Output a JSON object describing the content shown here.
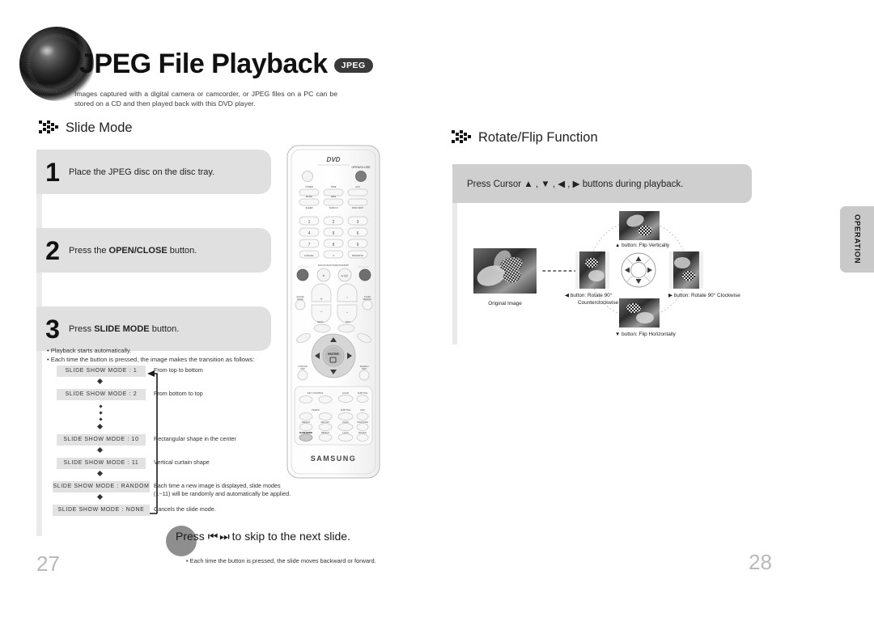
{
  "header": {
    "title": "JPEG File Playback",
    "badge": "JPEG",
    "intro": "Images captured with a digital camera or camcorder, or JPEG files on a PC can be stored on a CD and then played back with this DVD player."
  },
  "left": {
    "section_title": "Slide Mode",
    "steps": [
      {
        "num": "1",
        "text_before": "Place the JPEG disc on the disc tray.",
        "bold": "",
        "text_after": ""
      },
      {
        "num": "2",
        "text_before": "Press the ",
        "bold": "OPEN/CLOSE",
        "text_after": " button."
      },
      {
        "num": "3",
        "text_before": "Press ",
        "bold": "SLIDE MODE",
        "text_after": " button."
      }
    ],
    "notes": [
      "• Playback starts automatically.",
      "• Each time the button is pressed, the image makes the transition as follows:"
    ],
    "flow": [
      {
        "label": "SLIDE SHOW MODE : 1",
        "desc": "From top to bottom"
      },
      {
        "label": "SLIDE SHOW MODE : 2",
        "desc": "From bottom to top"
      },
      {
        "label": "SLIDE SHOW MODE : 10",
        "desc": "Rectangular shape in the center"
      },
      {
        "label": "SLIDE SHOW MODE : 11",
        "desc": "Vertical curtain shape"
      },
      {
        "label": "SLIDE SHOW MODE : RANDOM",
        "desc": "Each time a new image is displayed, slide modes\n(1~11) will be randomly and automatically be applied."
      },
      {
        "label": "SLIDE SHOW MODE : NONE",
        "desc": "Cancels the slide mode."
      }
    ],
    "press": {
      "prefix": "Press",
      "icons": "⏮ ⏭",
      "suffix": "to skip to the next slide.",
      "note": "• Each time the button is pressed, the slide moves backward or forward."
    },
    "page_number": "27"
  },
  "right": {
    "section_title": "Rotate/Flip Function",
    "cursor_instruction": "Press Cursor ▲ , ▼ , ◀ , ▶ buttons during playback.",
    "diagram": {
      "original_caption": "Original Image",
      "up_label": "▲ button: Flip Vertically",
      "down_label": "▼ button: Flip Horizontally",
      "left_label_line1": "◀ button: Rotate 90°",
      "left_label_line2": "Counterclockwise",
      "right_label": "▶ button: Rotate 90° Clockwise"
    },
    "side_tab": "OPERATION",
    "page_number": "28"
  },
  "remote": {
    "brand": "SAMSUNG",
    "top_logo": "DVD",
    "open_close": "OPEN/CLOSE",
    "row1": [
      "TUNER/BAND",
      "TAPE/REW",
      "AUX"
    ],
    "row2": [
      "SLEEP",
      "TAPE I/II",
      "DISC SKIP"
    ],
    "numbers": [
      "1",
      "2",
      "3",
      "4",
      "5",
      "6",
      "7",
      "8",
      "9"
    ],
    "bottom_num_row": [
      "CANCEL",
      "0",
      "RESERVE"
    ],
    "transport_label": "DVD/CD/DVD/TAPE/STANDBY",
    "volume_label": "VOLUME",
    "tuning_label": "TUNING",
    "sound_mode": "SOUND MODE",
    "tuner_memory": "TUNER/MEMORY",
    "enter": "ENTER",
    "menu": "MENU",
    "return": "RETURN",
    "slide_mode_key": "SLIDE MODE",
    "keypad_labels": [
      "KEY CONTROL",
      "TEMPO",
      "ZOOM",
      "SUBTITLE",
      "REPEAT",
      "MELODY",
      "AUDIO",
      "STEP/VIEW",
      "SLIDE MODE",
      "REPEAT",
      "LOGO",
      "ADVANC"
    ]
  },
  "colors": {
    "step_bg": "#e0e0e0",
    "cursor_bar_bg": "#cfcfcf",
    "flow_box_bg": "#e2e2e2",
    "tab_bg": "#c9c9c9",
    "page_number": "#b9b9b9",
    "badge_bg": "#3a3a3a",
    "press_circle": "#8e8e8e"
  }
}
